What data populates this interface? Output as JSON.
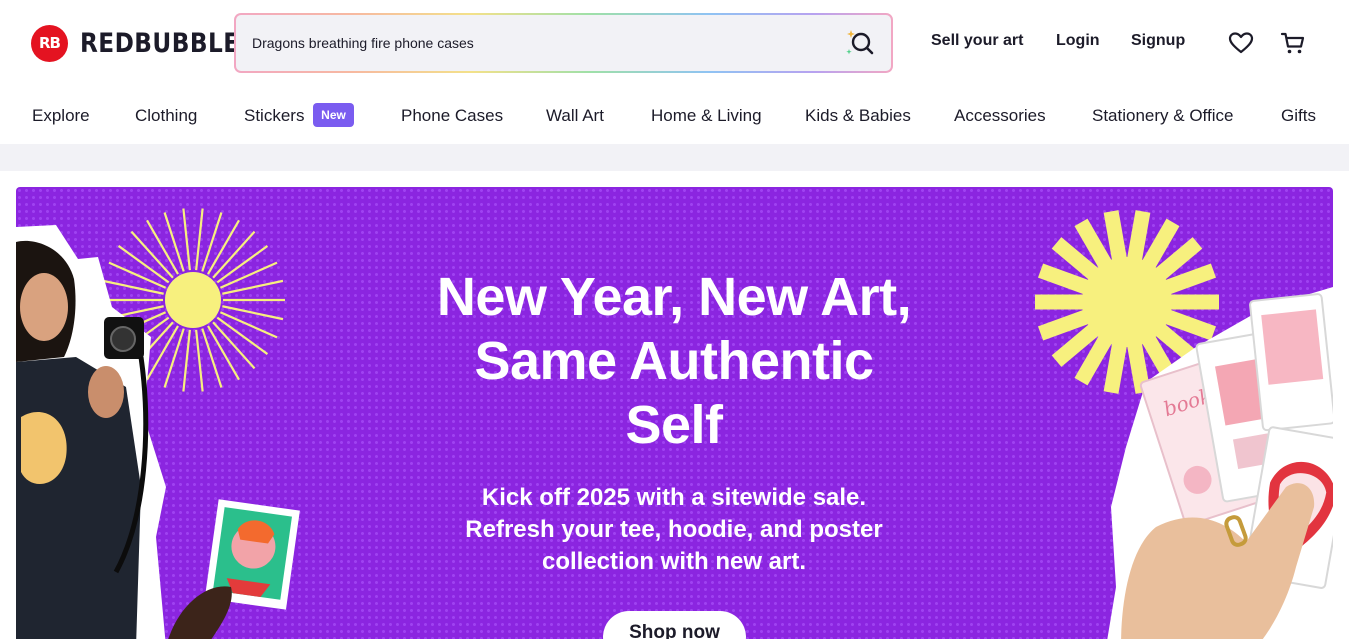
{
  "brand": {
    "logo_mark": "RB",
    "name": "REDBUBBLE",
    "color": "#e41321"
  },
  "search": {
    "value": "Dragons breathing fire phone cases",
    "icon": "search-icon"
  },
  "header_links": {
    "sell": "Sell your art",
    "login": "Login",
    "signup": "Signup"
  },
  "header_icons": [
    "heart-icon",
    "cart-icon"
  ],
  "categories": [
    "Explore",
    "Clothing",
    "Stickers",
    "Phone Cases",
    "Wall Art",
    "Home & Living",
    "Kids & Babies",
    "Accessories",
    "Stationery & Office",
    "Gifts"
  ],
  "stickers_badge": "New",
  "colors": {
    "hero_bg": "#8b25e0",
    "badge": "#7a5cf0",
    "sun": "#f7f07e",
    "text": "#1c1b29"
  },
  "hero": {
    "title": "New Year, New Art, Same Authentic Self",
    "subtitle": "Kick off 2025 with a sitewide sale. Refresh your tee, hoodie, and poster collection with new art.",
    "cta": "Shop now"
  }
}
